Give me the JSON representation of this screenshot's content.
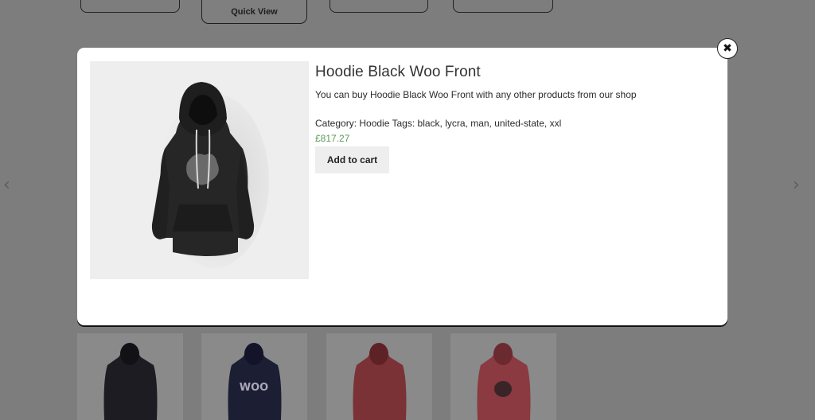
{
  "background": {
    "quick_view_label": "Quick View"
  },
  "modal": {
    "title": "Hoodie Black Woo Front",
    "description": "You can buy Hoodie Black Woo Front with any other products from our shop",
    "meta": "Category: Hoodie Tags: black, lycra, man, united-state, xxl",
    "price": "£817.27",
    "add_to_cart_label": "Add to cart",
    "close_glyph": "✖"
  },
  "icons": {
    "close": "close-icon",
    "prev": "chevron-left-icon",
    "next": "chevron-right-icon"
  },
  "colors": {
    "overlay": "#7d7d7d",
    "price": "#5b9a5c",
    "button_bg": "#eeeeee"
  }
}
